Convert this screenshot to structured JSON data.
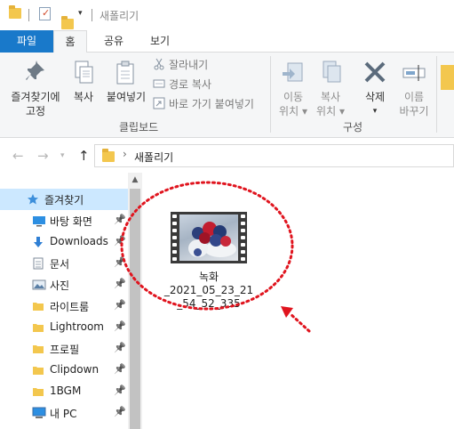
{
  "window": {
    "title": "새폴리기"
  },
  "ribbon_tabs": {
    "file": "파일",
    "home": "홈",
    "share": "공유",
    "view": "보기"
  },
  "clipboard": {
    "pin_quick_line1": "즐겨찾기에",
    "pin_quick_line2": "고정",
    "copy": "복사",
    "paste": "붙여넣기",
    "cut": "잘라내기",
    "copy_path": "경로 복사",
    "paste_shortcut": "바로 가기 붙여넣기",
    "group_label": "클립보드"
  },
  "organize": {
    "move_line1": "이동",
    "move_line2": "위치",
    "copyto_line1": "복사",
    "copyto_line2": "위치",
    "delete": "삭제",
    "rename_line1": "이름",
    "rename_line2": "바꾸기",
    "group_label": "구성"
  },
  "address": {
    "path": "새폴리기"
  },
  "nav": {
    "items": [
      {
        "label": "즐겨찾기",
        "icon": "star-icon",
        "selected": true
      },
      {
        "label": "바탕 화면",
        "icon": "desktop-icon",
        "pinned": true
      },
      {
        "label": "Downloads",
        "icon": "download-arrow-icon",
        "pinned": true
      },
      {
        "label": "문서",
        "icon": "document-icon",
        "pinned": true
      },
      {
        "label": "사진",
        "icon": "pictures-icon",
        "pinned": true
      },
      {
        "label": "라이트룸",
        "icon": "folder-icon",
        "pinned": true
      },
      {
        "label": "Lightroom",
        "icon": "folder-icon",
        "pinned": true
      },
      {
        "label": "프로필",
        "icon": "folder-icon",
        "pinned": true
      },
      {
        "label": "Clipdown",
        "icon": "folder-icon",
        "pinned": true
      },
      {
        "label": "1BGM",
        "icon": "folder-icon",
        "pinned": true
      },
      {
        "label": "내 PC",
        "icon": "pc-icon",
        "pinned": true
      }
    ]
  },
  "file": {
    "name_line1": "녹화",
    "name_line2": "_2021_05_23_21",
    "name_line3": "_54_52_335",
    "thumbnail_icon": "video-thumbnail-icon"
  },
  "colors": {
    "accent": "#1979ca",
    "annotation": "#e0141e",
    "selection": "#cce8ff"
  }
}
